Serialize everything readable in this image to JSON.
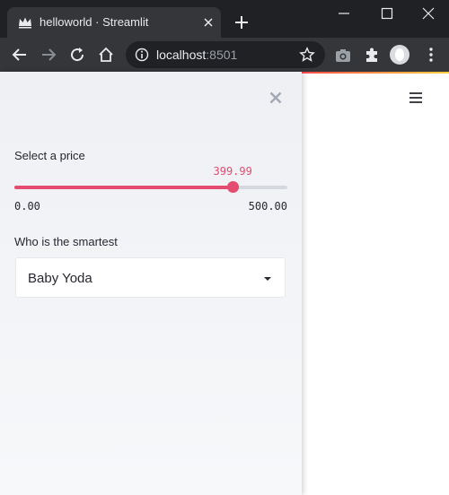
{
  "browser": {
    "tab_title": "helloworld · Streamlit",
    "url_host": "localhost",
    "url_port": ":8501"
  },
  "sidebar": {
    "slider": {
      "label": "Select a price",
      "value_text": "399.99",
      "value": 399.99,
      "min": 0,
      "max": 500,
      "min_text": "0.00",
      "max_text": "500.00",
      "color": "#e44d70"
    },
    "select": {
      "label": "Who is the smartest",
      "value": "Baby Yoda"
    }
  },
  "colors": {
    "accent": "#e44d70",
    "chrome_dark": "#202124",
    "chrome_tab": "#35363a"
  },
  "icons": {
    "favicon": "streamlit-crown-icon",
    "tab_close": "close-icon",
    "new_tab": "plus-icon",
    "back": "arrow-left-icon",
    "forward": "arrow-right-icon",
    "reload": "reload-icon",
    "home": "home-icon",
    "info": "info-icon",
    "bookmark": "star-icon",
    "camera": "camera-icon",
    "extensions": "puzzle-icon",
    "profile": "avatar-icon",
    "menu": "kebab-menu-icon",
    "sidebar_close": "close-icon",
    "hamburger": "hamburger-menu-icon",
    "select_arrow": "caret-down-icon"
  }
}
